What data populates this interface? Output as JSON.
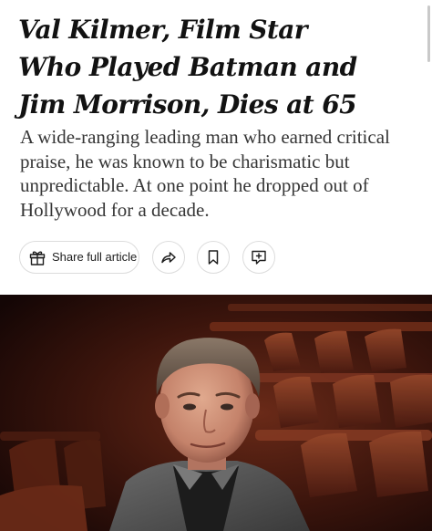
{
  "article": {
    "headline_lines": [
      "Val Kilmer, Film Star",
      "Who Played Batman and",
      "Jim Morrison, Dies at 65"
    ],
    "summary_lines": [
      "A wide-ranging leading man who earned critical",
      "praise, he was known to be charismatic but",
      "unpredictable. At one point he dropped out of",
      "Hollywood for a decade."
    ]
  },
  "actions": {
    "share_full_article": {
      "label": "Share full article",
      "icon": "gift-icon"
    },
    "share": {
      "icon": "share-arrow-icon"
    },
    "save": {
      "icon": "bookmark-icon"
    },
    "comments": {
      "icon": "comment-add-icon"
    }
  },
  "colors": {
    "headline": "#121212",
    "summary": "#363636",
    "pill_border": "#dcdcdc"
  }
}
